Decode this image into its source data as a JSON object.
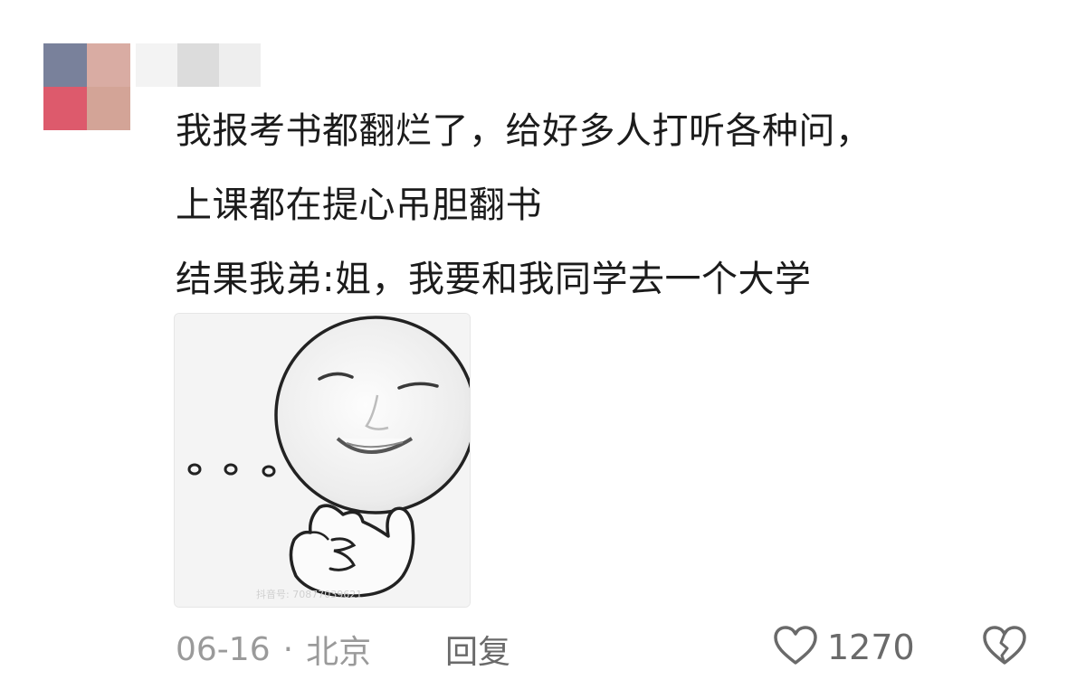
{
  "comment": {
    "author_avatar": {
      "colors": [
        "#79819b",
        "#d9aca3",
        "#dd5a6c",
        "#d3a497"
      ]
    },
    "username_blur_colors": [
      "#f0f0f0",
      "#d8d8d8",
      "#ebebeb"
    ],
    "lines": [
      "我报考书都翻烂了，给好多人打听各种问，",
      "上课都在提心吊胆翻书",
      "结果我弟:姐，我要和我同学去一个大学"
    ],
    "sticker": {
      "icon": "smirk-face-meme-sticker",
      "watermark": "抖音号: 70877039621"
    },
    "date": "06-16",
    "separator": "·",
    "location": "北京",
    "reply_label": "回复",
    "like_count": "1270",
    "like_icon": "heart-outline-icon",
    "dislike_icon": "broken-heart-icon",
    "text_color": "#1b1b1b",
    "meta_color": "#9a9a9a"
  }
}
